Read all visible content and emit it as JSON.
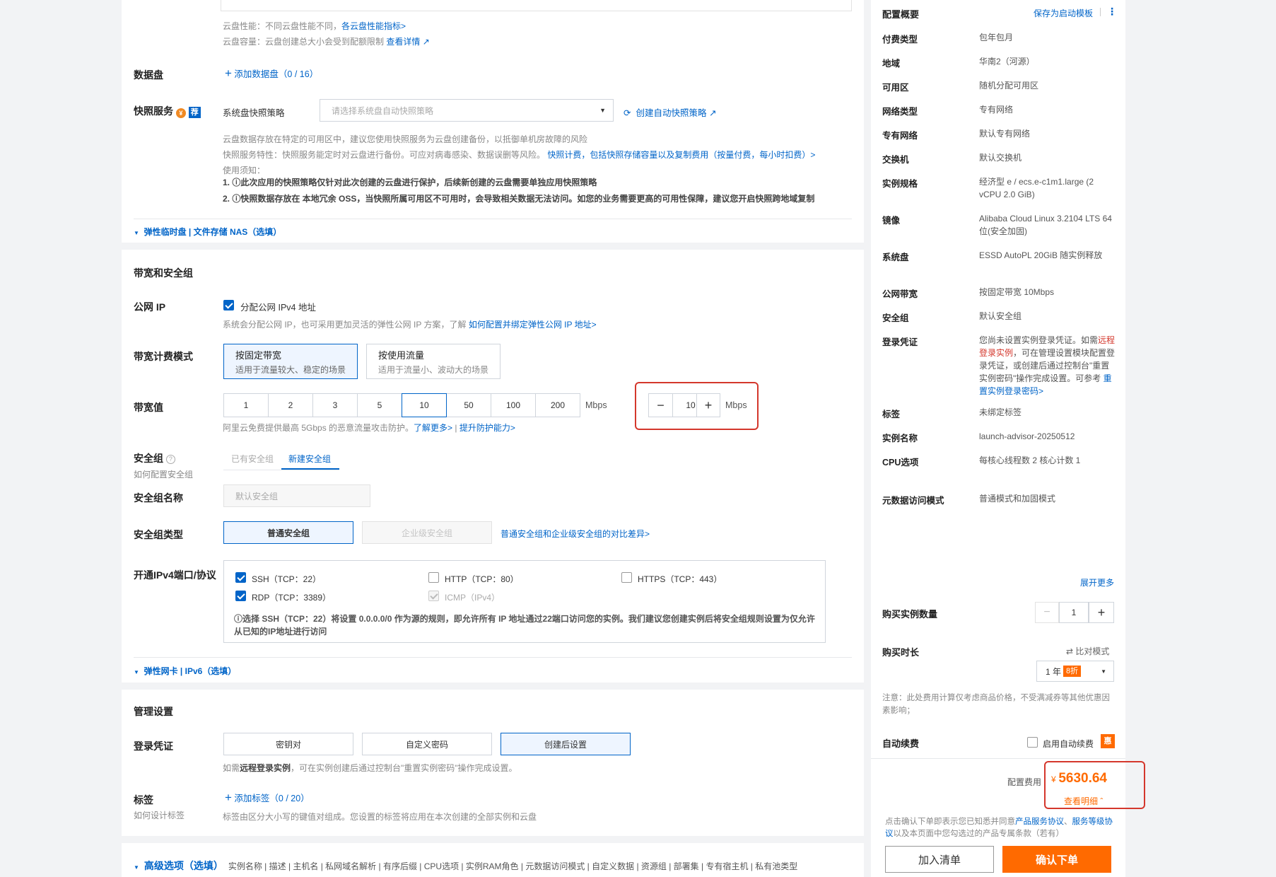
{
  "disk": {
    "perf_text": "云盘性能：不同云盘性能不同，",
    "perf_link": "各云盘性能指标>",
    "cap_text": "云盘容量：云盘创建总大小会受到配额限制",
    "cap_link": "查看详情",
    "data_disk_label": "数据盘",
    "add_data_disk": "添加数据盘（0 / 16）"
  },
  "snapshot": {
    "label": "快照服务",
    "badge": "荐",
    "policy_label": "系统盘快照策略",
    "policy_placeholder": "请选择系统盘自动快照策略",
    "create_link": "创建自动快照策略",
    "desc1": "云盘数据存放在特定的可用区中，建议您使用快照服务为云盘创建备份，以抵御单机房故障的风险",
    "desc2_prefix": "快照服务特性：快照服务能定时对云盘进行备份。可应对病毒感染、数据误删等风险。",
    "desc2_link": "快照计费，包括快照存储容量以及复制费用（按量付费，每小时扣费）>",
    "desc3": "使用须知：",
    "note1": "1. ⓘ此次应用的快照策略仅针对此次创建的云盘进行保护，后续新创建的云盘需要单独应用快照策略",
    "note2": "2. ⓘ快照数据存放在 本地冗余 OSS，当快照所属可用区不可用时，会导致相关数据无法访问。如您的业务需要更高的可用性保障，建议您开启快照跨地域复制",
    "elastic_link": "弹性临时盘 | 文件存储 NAS（选填）"
  },
  "network": {
    "section_title": "带宽和安全组",
    "public_ip_label": "公网 IP",
    "public_ip_checkbox": "分配公网 IPv4 地址",
    "public_ip_hint": "系统会分配公网 IP，也可采用更加灵活的弹性公网 IP 方案，了解",
    "public_ip_link": "如何配置并绑定弹性公网 IP 地址>",
    "billing_label": "带宽计费模式",
    "billing_fixed_title": "按固定带宽",
    "billing_fixed_sub": "适用于流量较大、稳定的场景",
    "billing_traffic_title": "按使用流量",
    "billing_traffic_sub": "适用于流量小、波动大的场景",
    "bw_label": "带宽值",
    "bw_options": [
      "1",
      "2",
      "3",
      "5",
      "10",
      "50",
      "100",
      "200"
    ],
    "bw_unit": "Mbps",
    "bw_value": "10",
    "ddos_hint": "阿里云免费提供最高 5Gbps 的恶意流量攻击防护。",
    "ddos_link1": "了解更多>",
    "ddos_sep": " | ",
    "ddos_link2": "提升防护能力>",
    "sg_label": "安全组",
    "sg_sub": "如何配置安全组",
    "sg_tab_existing": "已有安全组",
    "sg_tab_new": "新建安全组",
    "sg_name_label": "安全组名称",
    "sg_name_placeholder": "默认安全组",
    "sg_type_label": "安全组类型",
    "sg_type_normal": "普通安全组",
    "sg_type_enterprise": "企业级安全组",
    "sg_type_link": "普通安全组和企业级安全组的对比差异>",
    "ports_label": "开通IPv4端口/协议",
    "ports": {
      "ssh": "SSH（TCP：22）",
      "http": "HTTP（TCP：80）",
      "https": "HTTPS（TCP：443）",
      "rdp": "RDP（TCP：3389）",
      "icmp": "ICMP（IPv4）"
    },
    "ports_warn1": "ⓘ选择 SSH（TCP：22）将设置 0.0.0.0/0 作为源的规则，即允许所有 IP 地址通过22端口访问您的实例。我们建议您创建实例后将安全组规则设置为仅允许",
    "ports_warn2": "从已知的IP地址进行访问",
    "eni_link": "弹性网卡 | IPv6（选填）"
  },
  "mgmt": {
    "section_title": "管理设置",
    "login_label": "登录凭证",
    "login_keypair": "密钥对",
    "login_custom": "自定义密码",
    "login_after": "创建后设置",
    "login_hint_prefix": "如需",
    "login_hint_bold": "远程登录实例",
    "login_hint_suffix": "，可在实例创建后通过控制台\"重置实例密码\"操作完成设置。",
    "tag_label": "标签",
    "tag_sub": "如何设计标签",
    "add_tag": "添加标签（0 / 20）",
    "tag_hint": "标签由区分大小写的键值对组成。您设置的标签将应用在本次创建的全部实例和云盘",
    "advanced_link": "高级选项（选填）",
    "advanced_items": "实例名称 | 描述 | 主机名 | 私网域名解析 | 有序后缀 | CPU选项 | 实例RAM角色 | 元数据访问模式 | 自定义数据 | 资源组 | 部署集 | 专有宿主机 | 私有池类型"
  },
  "summary": {
    "title": "配置概要",
    "save_template": "保存为启动模板",
    "rows": [
      {
        "k": "付费类型",
        "v": "包年包月"
      },
      {
        "k": "地域",
        "v": "华南2（河源）"
      },
      {
        "k": "可用区",
        "v": "随机分配可用区"
      },
      {
        "k": "网络类型",
        "v": "专有网络"
      },
      {
        "k": "专有网络",
        "v": "默认专有网络"
      },
      {
        "k": "交换机",
        "v": "默认交换机"
      },
      {
        "k": "实例规格",
        "v": "经济型 e / ecs.e-c1m1.large (2 vCPU 2.0 GiB)"
      },
      {
        "k": "镜像",
        "v": "Alibaba Cloud Linux 3.2104 LTS 64位(安全加固)"
      },
      {
        "k": "系统盘",
        "v": "ESSD AutoPL 20GiB 随实例释放"
      },
      {
        "k": "公网带宽",
        "v": "按固定带宽 10Mbps"
      },
      {
        "k": "安全组",
        "v": "默认安全组"
      },
      {
        "k": "登录凭证",
        "v": ""
      },
      {
        "k": "标签",
        "v": "未绑定标签"
      },
      {
        "k": "实例名称",
        "v": "launch-advisor-20250512"
      },
      {
        "k": "CPU选项",
        "v": "每核心线程数 2 核心计数 1"
      },
      {
        "k": "元数据访问模式",
        "v": "普通模式和加固模式"
      }
    ],
    "login_v1": "您尚未设置实例登录凭证。如需",
    "login_red": "远程登录实例",
    "login_v2": "，可在管理设置模块配置登录凭证，或创建后通过控制台\"重置实例密码\"操作完成设置。可参考",
    "login_link": "重置实例登录密码>",
    "expand_more": "展开更多"
  },
  "purchase": {
    "qty_label": "购买实例数量",
    "qty_value": "1",
    "duration_label": "购买时长",
    "compare_mode": "比对模式",
    "duration_value": "1 年",
    "discount": "8折",
    "note": "注意：此处费用计算仅考虑商品价格，不受满减券等其他优惠因素影响；",
    "auto_renew_label": "自动续费",
    "auto_renew_checkbox": "启用自动续费",
    "auto_renew_badge": "惠",
    "fee_label": "配置费用",
    "currency": "¥",
    "fee_value": "5630.64",
    "detail_link": "查看明细",
    "agree_prefix": "点击确认下单即表示您已知悉并同意",
    "agree_link1": "产品服务协议",
    "agree_sep": "、",
    "agree_link2": "服务等级协议",
    "agree_suffix": "以及本页面中您勾选过的产品专属条款（若有）",
    "add_cart": "加入清单",
    "confirm": "确认下单"
  }
}
